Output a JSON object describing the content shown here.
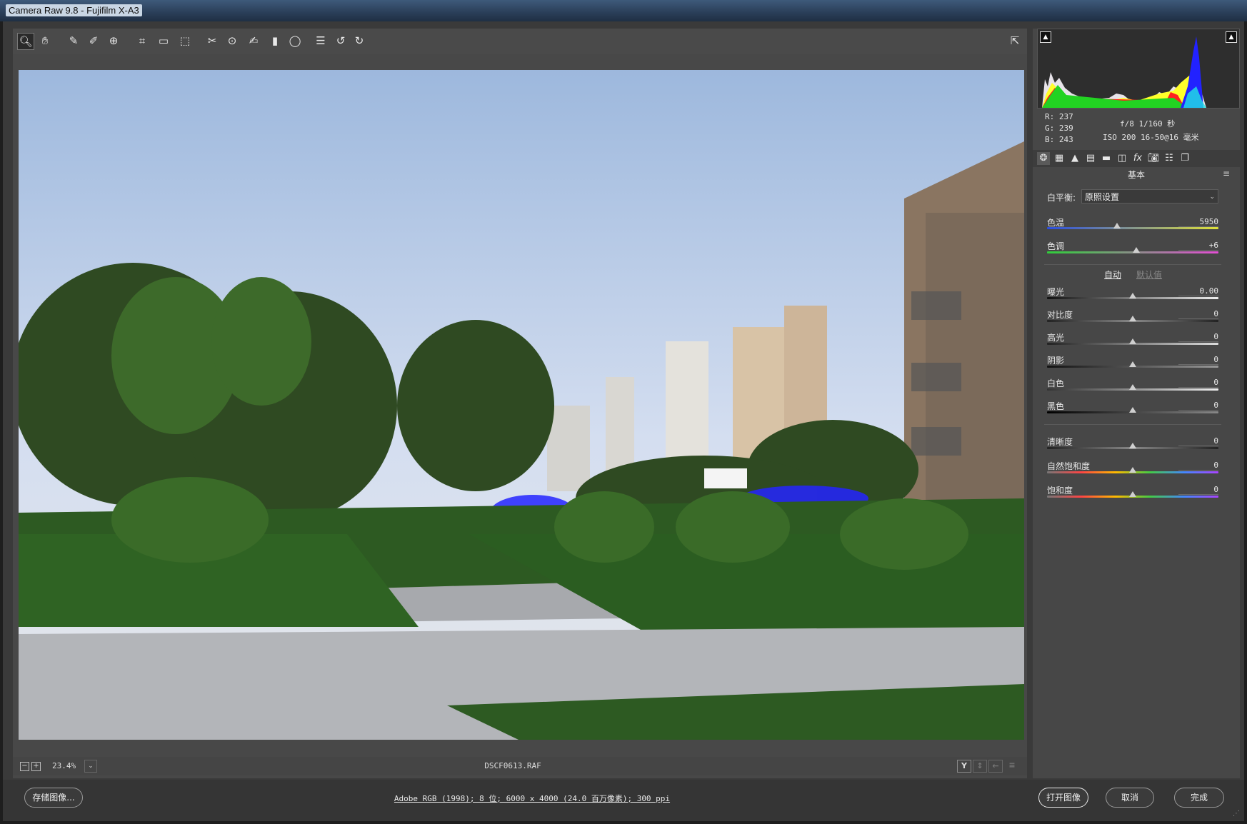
{
  "window": {
    "title": "Camera Raw 9.8 -  Fujifilm X-A3"
  },
  "toolbar": {
    "tools": [
      {
        "name": "zoom-tool-icon",
        "glyph": "🔍︎"
      },
      {
        "name": "hand-tool-icon",
        "glyph": "✋︎"
      },
      {
        "name": "white-balance-tool-icon",
        "glyph": "✎"
      },
      {
        "name": "color-sampler-tool-icon",
        "glyph": "✐"
      },
      {
        "name": "targeted-adjustment-tool-icon",
        "glyph": "⊕"
      },
      {
        "name": "crop-tool-icon",
        "glyph": "⌗"
      },
      {
        "name": "straighten-tool-icon",
        "glyph": "▭"
      },
      {
        "name": "transform-tool-icon",
        "glyph": "⬚"
      },
      {
        "name": "spot-removal-tool-icon",
        "glyph": "✂"
      },
      {
        "name": "red-eye-tool-icon",
        "glyph": "⊙"
      },
      {
        "name": "adjustment-brush-tool-icon",
        "glyph": "✍"
      },
      {
        "name": "graduated-filter-tool-icon",
        "glyph": "▮"
      },
      {
        "name": "radial-filter-tool-icon",
        "glyph": "◯"
      },
      {
        "name": "preferences-icon",
        "glyph": "☰"
      },
      {
        "name": "rotate-left-icon",
        "glyph": "↺"
      },
      {
        "name": "rotate-right-icon",
        "glyph": "↻"
      }
    ],
    "fullscreen_glyph": "⇱"
  },
  "preview": {
    "filename": "DSCF0613.RAF"
  },
  "zoom": {
    "value": "23.4%",
    "minus": "−",
    "plus": "+",
    "dropdown": "⌄"
  },
  "statusbar_icons": {
    "before_after": "Y",
    "swap": "↕",
    "copy": "←",
    "settings": "≡"
  },
  "histogram": {
    "readout": {
      "r": "R:  237",
      "g": "G:  239",
      "b": "B:  243"
    },
    "exif_line1": "f/8   1/160 秒",
    "exif_line2": "ISO 200   16-50@16 毫米"
  },
  "panel": {
    "title": "基本",
    "tabs": [
      "basic-tab-icon",
      "tone-curve-tab-icon",
      "detail-tab-icon",
      "hsl-tab-icon",
      "split-toning-tab-icon",
      "lens-corrections-tab-icon",
      "effects-tab-icon",
      "camera-calibration-tab-icon",
      "presets-tab-icon",
      "snapshots-tab-icon"
    ],
    "tab_glyphs": [
      "❂",
      "▦",
      "▲",
      "▤",
      "▬",
      "◫",
      "fx",
      "📷︎",
      "☷",
      "❐"
    ],
    "white_balance": {
      "label": "白平衡:",
      "value": "原照设置"
    },
    "auto": "自动",
    "default": "默认值",
    "sliders": [
      {
        "key": "temp",
        "label": "色温",
        "value": "5950",
        "pos": 0.41
      },
      {
        "key": "tint",
        "label": "色调",
        "value": "+6",
        "pos": 0.52
      },
      {
        "key": "exposure",
        "label": "曝光",
        "value": "0.00",
        "pos": 0.5
      },
      {
        "key": "contrast",
        "label": "对比度",
        "value": "0",
        "pos": 0.5
      },
      {
        "key": "highlights",
        "label": "高光",
        "value": "0",
        "pos": 0.5
      },
      {
        "key": "shadows",
        "label": "阴影",
        "value": "0",
        "pos": 0.5
      },
      {
        "key": "whites",
        "label": "白色",
        "value": "0",
        "pos": 0.5
      },
      {
        "key": "blacks",
        "label": "黑色",
        "value": "0",
        "pos": 0.5
      },
      {
        "key": "clarity",
        "label": "清晰度",
        "value": "0",
        "pos": 0.5
      },
      {
        "key": "vibrance",
        "label": "自然饱和度",
        "value": "0",
        "pos": 0.5
      },
      {
        "key": "saturation",
        "label": "饱和度",
        "value": "0",
        "pos": 0.5
      }
    ]
  },
  "bottom": {
    "save": "存储图像...",
    "workflow": "Adobe RGB (1998); 8 位; 6000 x 4000 (24.0 百万像素); 300 ppi",
    "open": "打开图像",
    "cancel": "取消",
    "done": "完成"
  }
}
